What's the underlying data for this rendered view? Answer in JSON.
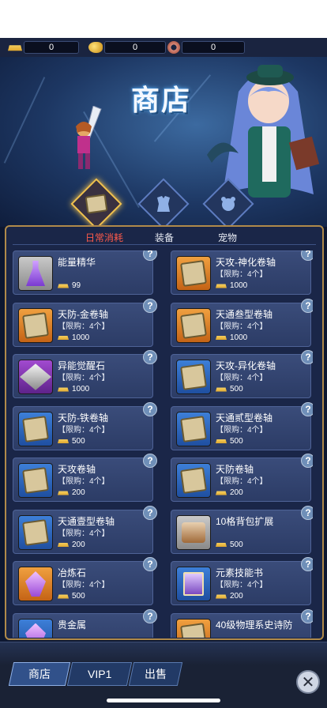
{
  "currencies": [
    {
      "icon": "gold-bar-icon",
      "value": "0"
    },
    {
      "icon": "gold-nugget-icon",
      "value": "0"
    },
    {
      "icon": "donut-icon",
      "value": "0"
    }
  ],
  "title": "商店",
  "categories": [
    "scroll-icon",
    "armor-icon",
    "pet-icon"
  ],
  "subtabs": [
    "日常消耗",
    "装备",
    "宠物"
  ],
  "items": [
    {
      "name": "能量精华",
      "limit": "",
      "price": "99",
      "icon": "flask-icon",
      "bg": "gray"
    },
    {
      "name": "天攻-神化卷轴",
      "limit": "【限购：4个】",
      "price": "1000",
      "icon": "scroll-icon",
      "bg": "orange"
    },
    {
      "name": "天防-金卷轴",
      "limit": "【限购：4个】",
      "price": "1000",
      "icon": "scroll-icon",
      "bg": "orange"
    },
    {
      "name": "天通叁型卷轴",
      "limit": "【限购：4个】",
      "price": "1000",
      "icon": "scroll-icon",
      "bg": "orange"
    },
    {
      "name": "异能觉醒石",
      "limit": "【限购：4个】",
      "price": "1000",
      "icon": "cube-icon",
      "bg": "purple"
    },
    {
      "name": "天攻-异化卷轴",
      "limit": "【限购：4个】",
      "price": "500",
      "icon": "scroll-icon",
      "bg": "blue"
    },
    {
      "name": "天防-铁卷轴",
      "limit": "【限购：4个】",
      "price": "500",
      "icon": "scroll-icon",
      "bg": "blue"
    },
    {
      "name": "天通贰型卷轴",
      "limit": "【限购：4个】",
      "price": "500",
      "icon": "scroll-icon",
      "bg": "blue"
    },
    {
      "name": "天攻卷轴",
      "limit": "【限购：4个】",
      "price": "200",
      "icon": "scroll-icon",
      "bg": "blue"
    },
    {
      "name": "天防卷轴",
      "limit": "【限购：4个】",
      "price": "200",
      "icon": "scroll-icon",
      "bg": "blue"
    },
    {
      "name": "天通壹型卷轴",
      "limit": "【限购：4个】",
      "price": "200",
      "icon": "scroll-icon",
      "bg": "blue"
    },
    {
      "name": "10格背包扩展",
      "limit": "",
      "price": "500",
      "icon": "chest-icon",
      "bg": "gray"
    },
    {
      "name": "冶炼石",
      "limit": "【限购：4个】",
      "price": "500",
      "icon": "crystal-icon",
      "bg": "orange"
    },
    {
      "name": "元素技能书",
      "limit": "【限购：4个】",
      "price": "200",
      "icon": "book-icon",
      "bg": "blue"
    },
    {
      "name": "贵金属",
      "limit": "",
      "price": "",
      "icon": "crystal-icon",
      "bg": "blue"
    },
    {
      "name": "40级物理系史诗防",
      "limit": "",
      "price": "",
      "icon": "scroll-icon",
      "bg": "orange"
    }
  ],
  "bottom_tabs": [
    "商店",
    "VIP1",
    "出售"
  ],
  "close_label": "✕",
  "help_label": "?"
}
